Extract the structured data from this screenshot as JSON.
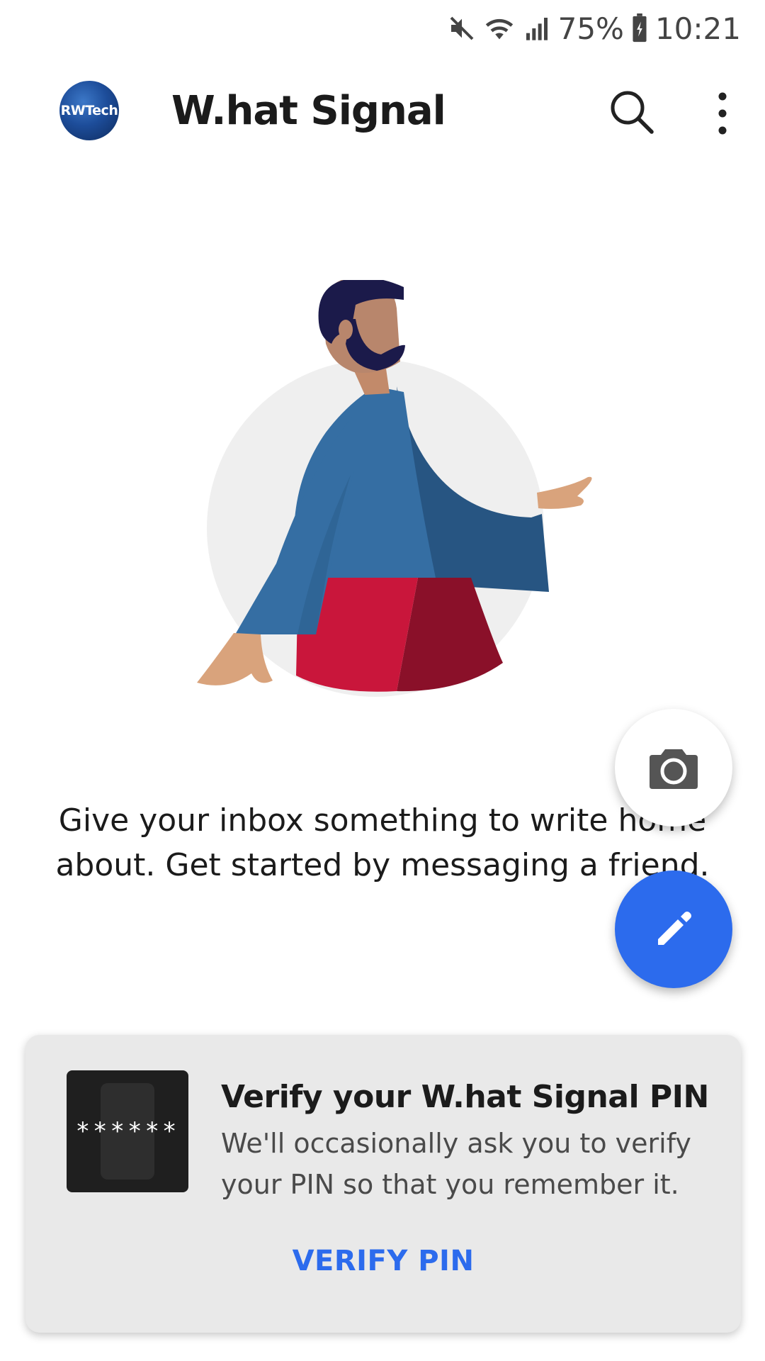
{
  "status_bar": {
    "battery": "75%",
    "time": "10:21",
    "icons": [
      "mute-icon",
      "wifi-icon",
      "signal-icon",
      "battery-charging-icon"
    ]
  },
  "toolbar": {
    "avatar_text": "RWTech",
    "title": "W.hat Signal",
    "icons": [
      "search-icon",
      "more-vert-icon"
    ]
  },
  "empty_state": {
    "line1": "Give your inbox something to write home",
    "line2": "about. Get started by messaging a friend.",
    "illustration": "person-pointing-illustration"
  },
  "fabs": {
    "camera_icon": "camera-icon",
    "compose_icon": "pencil-icon",
    "compose_color": "#2c6bed"
  },
  "megaphone": {
    "image_text": "******",
    "title": "Verify your W.hat Signal PIN",
    "body": "We'll occasionally ask you to verify your PIN so that you remember it.",
    "action": "VERIFY PIN"
  },
  "colors": {
    "accent": "#2c6bed",
    "card_bg": "#e9e9e9",
    "shirt": "#356ea3",
    "pants": "#c9163b"
  }
}
